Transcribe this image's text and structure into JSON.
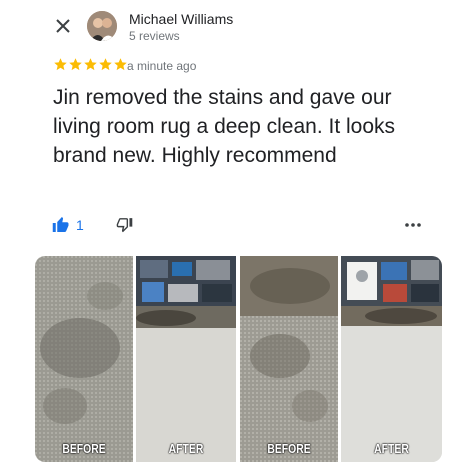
{
  "review": {
    "author_name": "Michael Williams",
    "author_meta": "5 reviews",
    "rating": 5,
    "timestamp": "a minute ago",
    "text": "Jin removed the stains and gave our living room rug a deep clean. It looks brand new. Highly recommend"
  },
  "actions": {
    "like_count": "1",
    "like_icon": "thumbs-up-icon",
    "dislike_icon": "thumbs-down-icon",
    "more_icon": "more-horizontal-icon",
    "close_icon": "close-icon"
  },
  "photos": [
    {
      "caption": "BEFORE"
    },
    {
      "caption": "AFTER"
    },
    {
      "caption": "BEFORE"
    },
    {
      "caption": "AFTER"
    }
  ],
  "colors": {
    "star": "#fbbc04",
    "accent": "#1a73e8",
    "secondary_text": "#70757a"
  }
}
